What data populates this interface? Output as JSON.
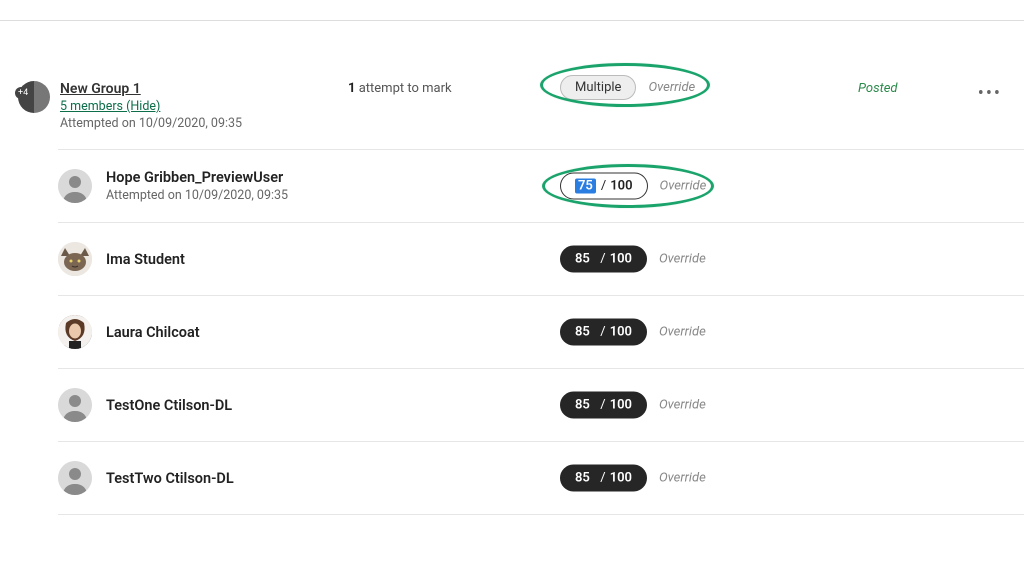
{
  "group": {
    "name": "New Group 1",
    "members_link": "5 members (Hide)",
    "attempted": "Attempted on 10/09/2020, 09:35",
    "attempts_text_bold": "1",
    "attempts_text_rest": " attempt to mark",
    "multiple_label": "Multiple",
    "override_label": "Override",
    "status": "Posted",
    "avatar_badge": "+4"
  },
  "members": [
    {
      "name": "Hope Gribben_PreviewUser",
      "sub": "Attempted on 10/09/2020, 09:35",
      "score": "75",
      "max": "100",
      "override": "Override",
      "editable": true,
      "avatar_kind": "silhouette"
    },
    {
      "name": "Ima Student",
      "sub": "",
      "score": "85",
      "max": "100",
      "override": "Override",
      "editable": false,
      "avatar_kind": "cat"
    },
    {
      "name": "Laura Chilcoat",
      "sub": "",
      "score": "85",
      "max": "100",
      "override": "Override",
      "editable": false,
      "avatar_kind": "laura"
    },
    {
      "name": "TestOne Ctilson-DL",
      "sub": "",
      "score": "85",
      "max": "100",
      "override": "Override",
      "editable": false,
      "avatar_kind": "silhouette"
    },
    {
      "name": "TestTwo Ctilson-DL",
      "sub": "",
      "score": "85",
      "max": "100",
      "override": "Override",
      "editable": false,
      "avatar_kind": "silhouette"
    }
  ]
}
